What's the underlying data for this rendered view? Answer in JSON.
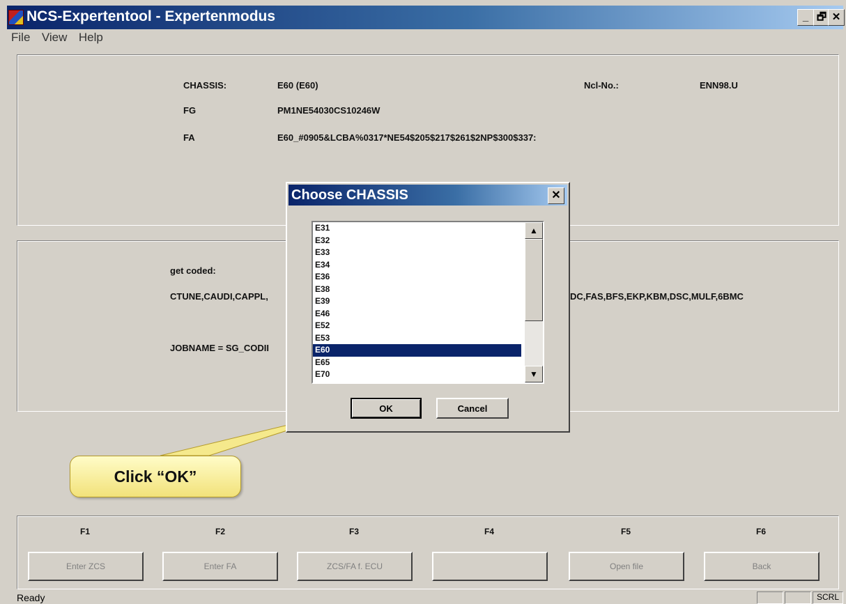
{
  "window": {
    "title": "NCS-Expertentool - Expertenmodus",
    "btn_min": "_",
    "btn_restore": "🗗",
    "btn_close": "✕"
  },
  "menu": [
    "File",
    "View",
    "Help"
  ],
  "info": {
    "chassis_label": "CHASSIS:",
    "chassis_value": "E60 (E60)",
    "ncl_label": "Ncl-No.:",
    "ncl_value": "ENN98.U",
    "fg_label": "FG",
    "fg_value": "PM1NE54030CS10246W",
    "fa_label": "FA",
    "fa_value": "E60_#0905&LCBA%0317*NE54$205$217$261$2NP$300$337:"
  },
  "coded": {
    "label": "get coded:",
    "modules_left": "CTUNE,CAUDI,CAPPL,",
    "modules_right": "DC,FAS,BFS,EKP,KBM,DSC,MULF,6BMC",
    "jobname": "JOBNAME = SG_CODII"
  },
  "dialog": {
    "title": "Choose CHASSIS",
    "close": "✕",
    "items": [
      "E31",
      "E32",
      "E33",
      "E34",
      "E36",
      "E38",
      "E39",
      "E46",
      "E52",
      "E53",
      "E60",
      "E65",
      "E70"
    ],
    "selected": "E60",
    "ok": "OK",
    "cancel": "Cancel",
    "scroll_up": "▲",
    "scroll_down": "▼"
  },
  "callout": {
    "text": "Click “OK”"
  },
  "fkeys": [
    {
      "key": "F1",
      "label": "Enter ZCS"
    },
    {
      "key": "F2",
      "label": "Enter FA"
    },
    {
      "key": "F3",
      "label": "ZCS/FA f. ECU"
    },
    {
      "key": "F4",
      "label": ""
    },
    {
      "key": "F5",
      "label": "Open file"
    },
    {
      "key": "F6",
      "label": "Back"
    }
  ],
  "status": {
    "text": "Ready",
    "scrl": "SCRL"
  }
}
